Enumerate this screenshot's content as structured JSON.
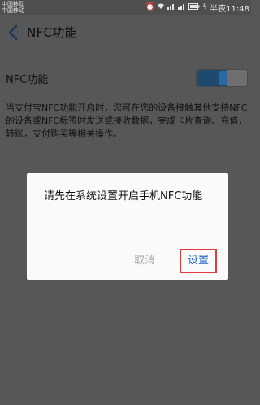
{
  "status_bar": {
    "carrier_1": "中国移动",
    "carrier_2": "中国移动",
    "time": "半夜11:48",
    "icons": [
      "alarm-icon",
      "wifi-icon",
      "signal-icon",
      "signal-icon",
      "battery-icon",
      "charging-icon"
    ]
  },
  "header": {
    "title": "NFC功能"
  },
  "nfc_setting": {
    "label": "NFC功能",
    "toggle_on": true
  },
  "description": "当支付宝NFC功能开启时，您可在您的设备接触其他支持NFC的设备或NFC标签时发送或接收数据，完成卡片查询、充值，转账，支付购买等相关操作。",
  "dialog": {
    "message": "请先在系统设置开启手机NFC功能",
    "cancel_label": "取消",
    "settings_label": "设置"
  },
  "colors": {
    "overlay": "#575757",
    "dialog_bg": "#fafafa",
    "settings_text": "#1f63c4",
    "highlight_border": "#e23a3a",
    "toggle_on": "#1e4a70"
  }
}
